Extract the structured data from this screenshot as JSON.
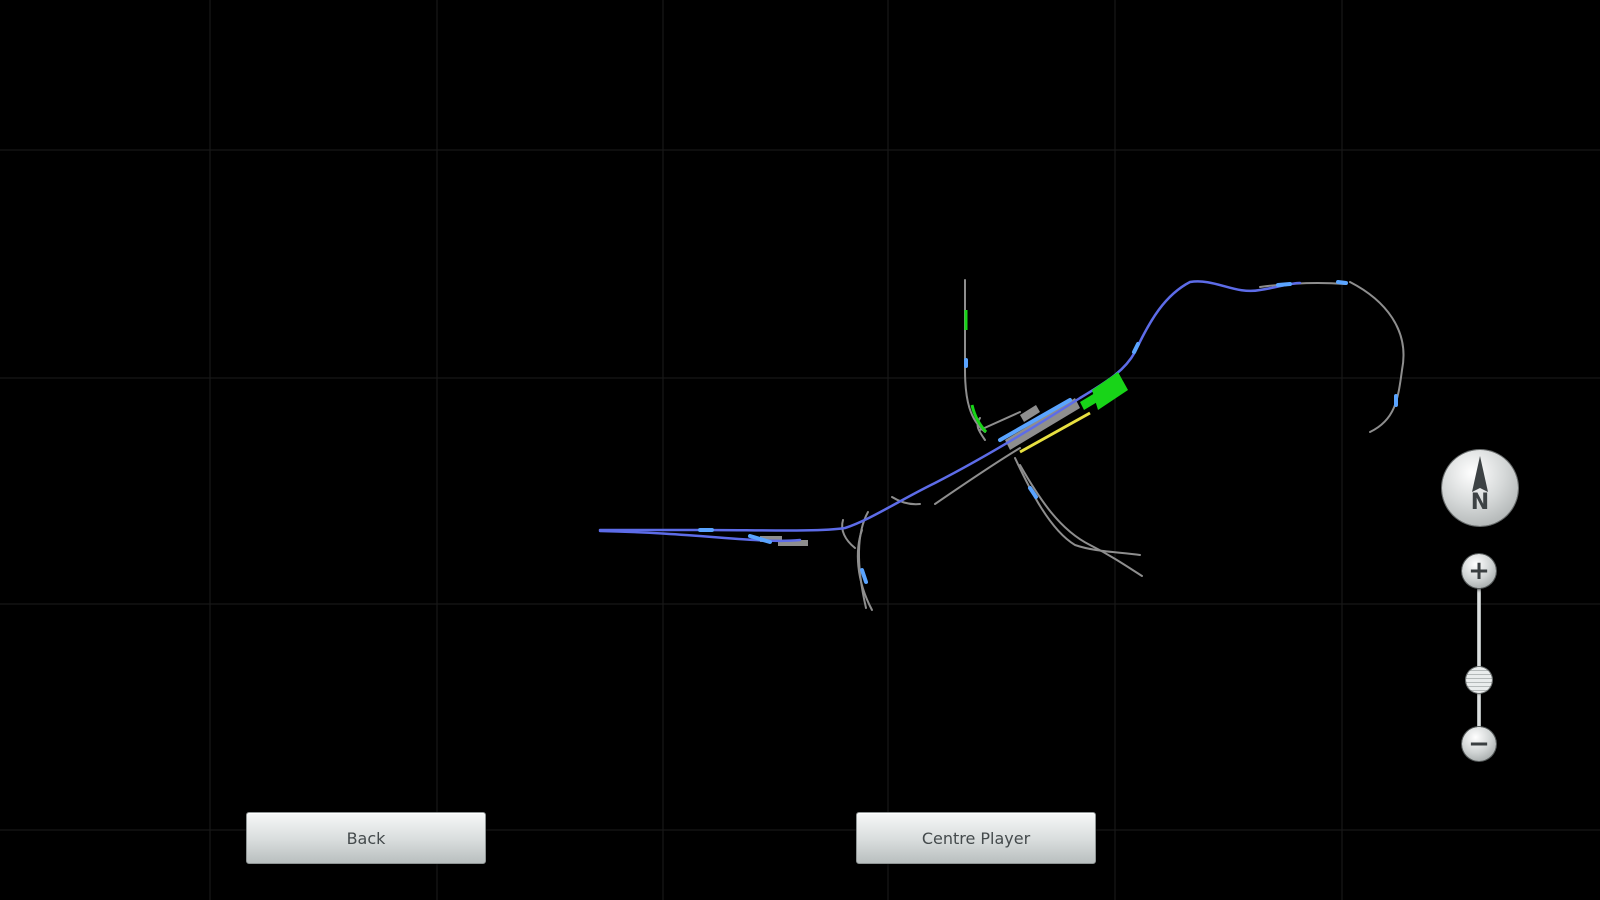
{
  "buttons": {
    "back_label": "Back",
    "centre_label": "Centre Player"
  },
  "compass": {
    "letter": "N",
    "icon": "compass-north-icon"
  },
  "zoom": {
    "in_symbol": "+",
    "out_symbol": "−",
    "level": 0.62
  },
  "colors": {
    "background": "#000000",
    "grid": "#1c1c1c",
    "route": "#5d6ce8",
    "track": "#8e8e8e",
    "signal": "#5aa4ff",
    "station": "#18d418",
    "platform_yellow": "#e8e040"
  }
}
